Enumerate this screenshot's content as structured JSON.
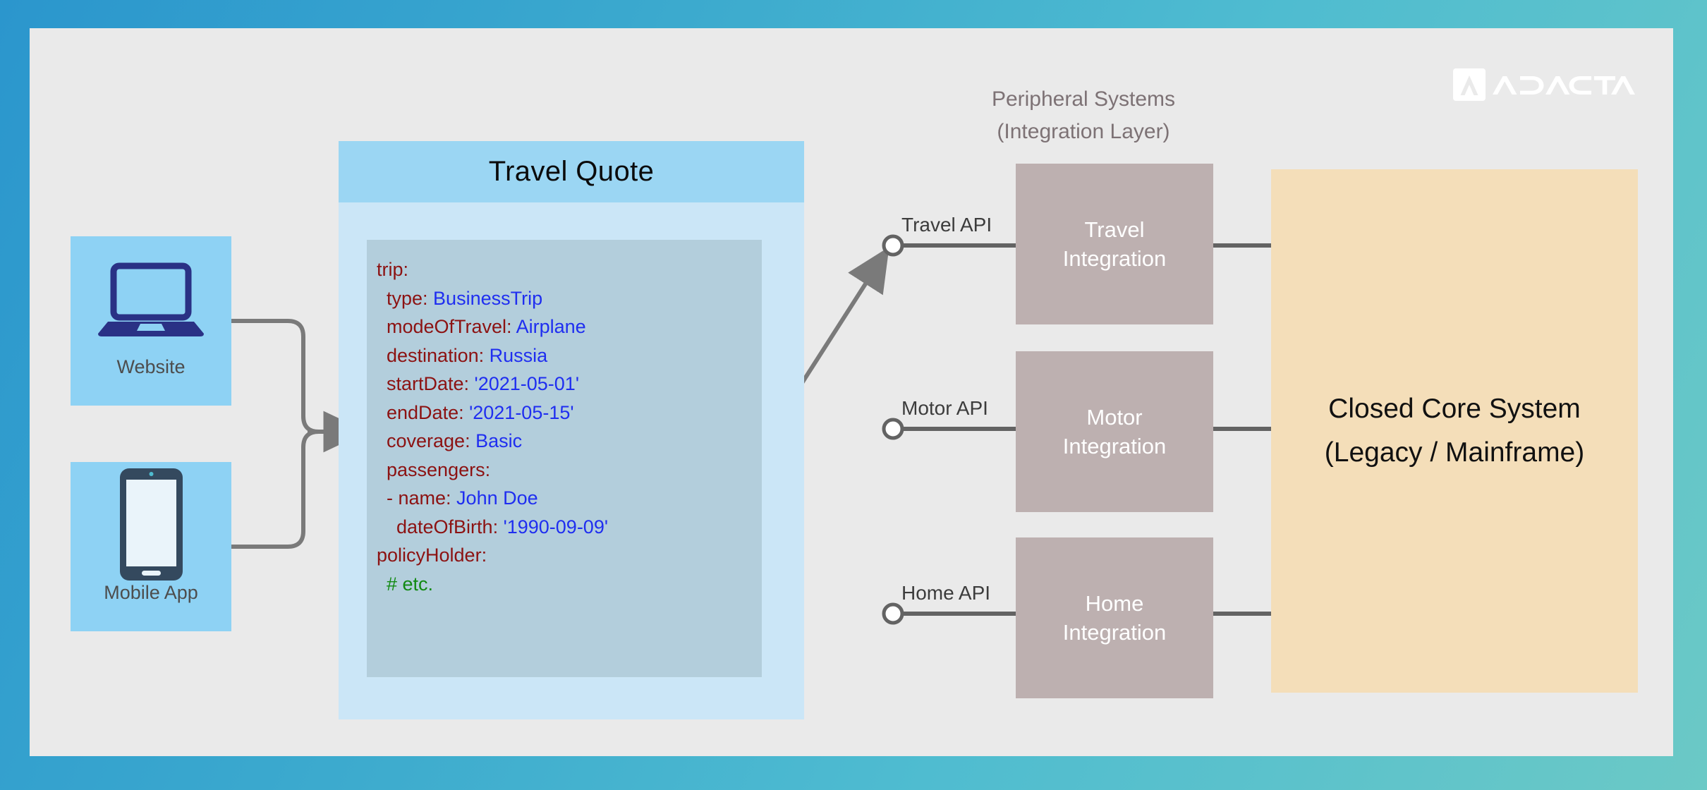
{
  "theme": {
    "background_gradient_from": "#2b96cd",
    "background_gradient_to": "#6bc9c6",
    "slide_background": "#eaeaea",
    "channel_tile": "#8ed2f4",
    "card_body": "#cbe6f7",
    "card_header": "#9bd6f3",
    "code_panel": "#b3cedc",
    "integration_box": "#bdb0b0",
    "core_box": "#f4deb9",
    "connector": "#7a7a7a",
    "key_color": "#8c1212",
    "value_color": "#1f2ef0",
    "comment_color": "#128a12"
  },
  "brand": {
    "logo_name": "adacta-logo",
    "wordmark": "ADACTA"
  },
  "channels": [
    {
      "label": "Website",
      "icon": "laptop-icon"
    },
    {
      "label": "Mobile App",
      "icon": "smartphone-icon"
    }
  ],
  "quote_card": {
    "title": "Travel  Quote",
    "code_lines": [
      {
        "indent": 0,
        "key": "trip:",
        "value": ""
      },
      {
        "indent": 1,
        "key": "type:",
        "value": "BusinessTrip"
      },
      {
        "indent": 1,
        "key": "modeOfTravel:",
        "value": "Airplane"
      },
      {
        "indent": 1,
        "key": "destination:",
        "value": "Russia"
      },
      {
        "indent": 1,
        "key": "startDate:",
        "value": "'2021-05-01'"
      },
      {
        "indent": 1,
        "key": "endDate:",
        "value": "'2021-05-15'"
      },
      {
        "indent": 1,
        "key": "coverage:",
        "value": "Basic"
      },
      {
        "indent": 1,
        "key": "passengers:",
        "value": ""
      },
      {
        "indent": 1,
        "key": "- name:",
        "value": "John Doe"
      },
      {
        "indent": 2,
        "key": "dateOfBirth:",
        "value": "'1990-09-09'"
      },
      {
        "indent": 0,
        "key": "policyHolder:",
        "value": ""
      },
      {
        "indent": 1,
        "comment": "# etc."
      }
    ]
  },
  "peripheral": {
    "heading_line1": "Peripheral Systems",
    "heading_line2": "(Integration Layer)",
    "systems": [
      {
        "api_label": "Travel API",
        "line1": "Travel",
        "line2": "Integration"
      },
      {
        "api_label": "Motor API",
        "line1": "Motor",
        "line2": "Integration"
      },
      {
        "api_label": "Home API",
        "line1": "Home",
        "line2": "Integration"
      }
    ]
  },
  "core_system": {
    "line1": "Closed Core System",
    "line2": "(Legacy / Mainframe)"
  }
}
